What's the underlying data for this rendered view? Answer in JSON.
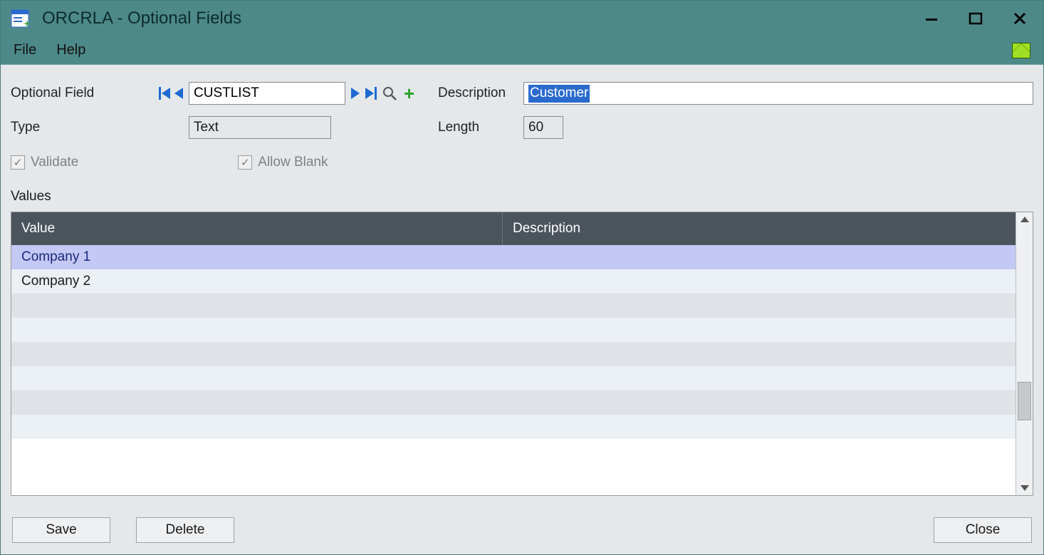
{
  "window": {
    "title": "ORCRLA - Optional Fields"
  },
  "menu": {
    "file": "File",
    "help": "Help"
  },
  "form": {
    "optional_field_label": "Optional Field",
    "optional_field_value": "CUSTLIST",
    "description_label": "Description",
    "description_value": "Customer",
    "type_label": "Type",
    "type_value": "Text",
    "length_label": "Length",
    "length_value": "60",
    "validate_label": "Validate",
    "validate_checked": true,
    "allow_blank_label": "Allow Blank",
    "allow_blank_checked": true
  },
  "values": {
    "section_label": "Values",
    "columns": {
      "value": "Value",
      "description": "Description"
    },
    "rows": [
      {
        "value": "Company 1",
        "description": "",
        "selected": true
      },
      {
        "value": "Company 2",
        "description": "",
        "selected": false
      }
    ]
  },
  "buttons": {
    "save": "Save",
    "delete": "Delete",
    "close": "Close"
  }
}
